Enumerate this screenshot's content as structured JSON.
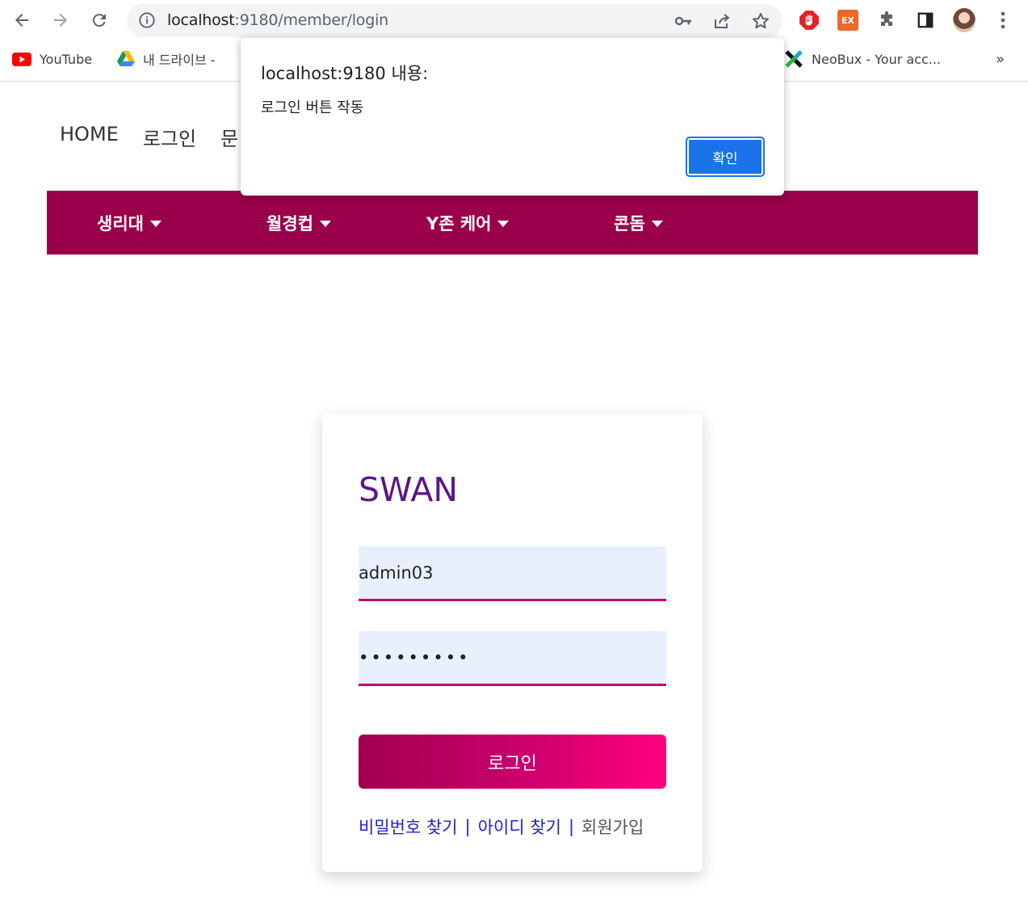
{
  "browser": {
    "url_host": "localhost",
    "url_rest": ":9180/member/login",
    "bookmarks": [
      {
        "label": "YouTube",
        "icon": "youtube-icon"
      },
      {
        "label": "내 드라이브 - ",
        "icon": "google-drive-icon"
      },
      {
        "label": "NeoBux - Your acc...",
        "icon": "neobux-icon"
      }
    ],
    "more_bookmarks": "»",
    "ext_badge": "EX"
  },
  "site": {
    "topnav": [
      "HOME",
      "로그인",
      "문"
    ],
    "menu": [
      {
        "label": "생리대"
      },
      {
        "label": "월경컵"
      },
      {
        "label": "Y존 케어"
      },
      {
        "label": "콘돔"
      }
    ],
    "menu_color": "#9b004a"
  },
  "login": {
    "brand": "SWAN",
    "username_value": "admin03",
    "password_value": "•••••••••",
    "submit_label": "로그인",
    "links": {
      "find_password": "비밀번호 찾기",
      "find_id": "아이디 찾기",
      "signup": "회원가입",
      "separator": "|"
    }
  },
  "dialog": {
    "title": "localhost:9180 내용:",
    "message": "로그인 버튼 작동",
    "ok_label": "확인"
  }
}
